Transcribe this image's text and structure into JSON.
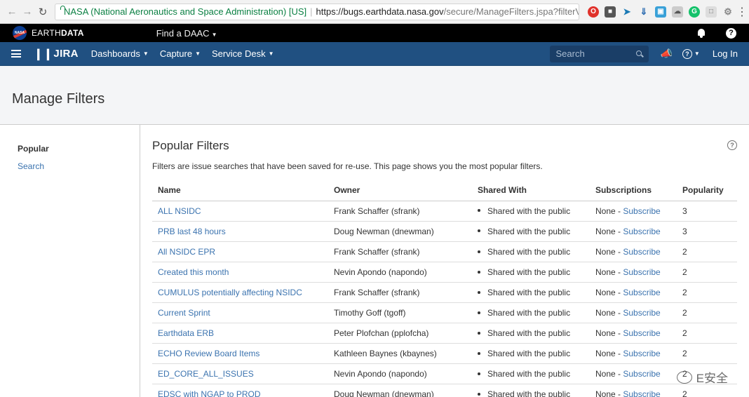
{
  "browser": {
    "ev_label": "NASA (National Aeronautics and Space Administration) [US]",
    "url_host": "https://bugs.earthdata.nasa.gov",
    "url_path": "/secure/ManageFilters.jspa?filterVi..."
  },
  "earthdata": {
    "brand_light": "EARTH",
    "brand_bold": "DATA",
    "nasa_logo_text": "NASA",
    "find_daac": "Find a DAAC"
  },
  "jira": {
    "logo": "JIRA",
    "nav": [
      {
        "label": "Dashboards"
      },
      {
        "label": "Capture"
      },
      {
        "label": "Service Desk"
      }
    ],
    "search_placeholder": "Search",
    "login": "Log In"
  },
  "page": {
    "title": "Manage Filters"
  },
  "sidebar": {
    "items": [
      {
        "label": "Popular"
      },
      {
        "label": "Search"
      }
    ]
  },
  "main": {
    "heading": "Popular Filters",
    "description": "Filters are issue searches that have been saved for re-use. This page shows you the most popular filters.",
    "columns": [
      "Name",
      "Owner",
      "Shared With",
      "Subscriptions",
      "Popularity"
    ],
    "rows": [
      {
        "name": "ALL NSIDC",
        "owner": "Frank Schaffer (sfrank)",
        "shared": "Shared with the public",
        "subs_prefix": "None - ",
        "subs_link": "Subscribe",
        "popularity": "3"
      },
      {
        "name": "PRB last 48 hours",
        "owner": "Doug Newman (dnewman)",
        "shared": "Shared with the public",
        "subs_prefix": "None - ",
        "subs_link": "Subscribe",
        "popularity": "3"
      },
      {
        "name": "All NSIDC EPR",
        "owner": "Frank Schaffer (sfrank)",
        "shared": "Shared with the public",
        "subs_prefix": "None - ",
        "subs_link": "Subscribe",
        "popularity": "2"
      },
      {
        "name": "Created this month",
        "owner": "Nevin Apondo (napondo)",
        "shared": "Shared with the public",
        "subs_prefix": "None - ",
        "subs_link": "Subscribe",
        "popularity": "2"
      },
      {
        "name": "CUMULUS potentially affecting NSIDC",
        "owner": "Frank Schaffer (sfrank)",
        "shared": "Shared with the public",
        "subs_prefix": "None - ",
        "subs_link": "Subscribe",
        "popularity": "2"
      },
      {
        "name": "Current Sprint",
        "owner": "Timothy Goff (tgoff)",
        "shared": "Shared with the public",
        "subs_prefix": "None - ",
        "subs_link": "Subscribe",
        "popularity": "2"
      },
      {
        "name": "Earthdata ERB",
        "owner": "Peter Plofchan (pplofcha)",
        "shared": "Shared with the public",
        "subs_prefix": "None - ",
        "subs_link": "Subscribe",
        "popularity": "2"
      },
      {
        "name": "ECHO Review Board Items",
        "owner": "Kathleen Baynes (kbaynes)",
        "shared": "Shared with the public",
        "subs_prefix": "None - ",
        "subs_link": "Subscribe",
        "popularity": "2"
      },
      {
        "name": "ED_CORE_ALL_ISSUES",
        "owner": "Nevin Apondo (napondo)",
        "shared": "Shared with the public",
        "subs_prefix": "None - ",
        "subs_link": "Subscribe",
        "popularity": "2"
      },
      {
        "name": "EDSC with NGAP to PROD",
        "owner": "Doug Newman (dnewman)",
        "shared": "Shared with the public",
        "subs_prefix": "None - ",
        "subs_link": "Subscribe",
        "popularity": "2"
      }
    ]
  },
  "watermark": {
    "text": "E安全"
  }
}
